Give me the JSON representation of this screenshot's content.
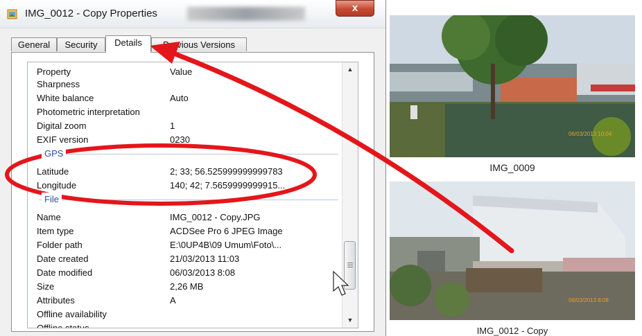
{
  "window": {
    "title": "IMG_0012 - Copy Properties",
    "close_label": "x"
  },
  "tabs": [
    {
      "label": "General",
      "active": false
    },
    {
      "label": "Security",
      "active": false
    },
    {
      "label": "Details",
      "active": true
    },
    {
      "label": "Previous Versions",
      "active": false
    }
  ],
  "details": {
    "header": {
      "property": "Property",
      "value": "Value"
    },
    "rows_top": [
      {
        "property": "Sharpness",
        "value": ""
      },
      {
        "property": "White balance",
        "value": "Auto"
      },
      {
        "property": "Photometric interpretation",
        "value": ""
      },
      {
        "property": "Digital zoom",
        "value": "1"
      },
      {
        "property": "EXIF version",
        "value": "0230"
      }
    ],
    "gps_group": "GPS",
    "rows_gps": [
      {
        "property": "Latitude",
        "value": "2; 33; 56.525999999999783"
      },
      {
        "property": "Longitude",
        "value": "140; 42; 7.5659999999915..."
      }
    ],
    "file_group": "File",
    "rows_file": [
      {
        "property": "Name",
        "value": "IMG_0012 - Copy.JPG"
      },
      {
        "property": "Item type",
        "value": "ACDSee Pro 6 JPEG Image"
      },
      {
        "property": "Folder path",
        "value": "E:\\0UP4B\\09 Umum\\Foto\\..."
      },
      {
        "property": "Date created",
        "value": "21/03/2013 11:03"
      },
      {
        "property": "Date modified",
        "value": "06/03/2013 8:08"
      },
      {
        "property": "Size",
        "value": "2,26 MB"
      },
      {
        "property": "Attributes",
        "value": "A"
      },
      {
        "property": "Offline availability",
        "value": ""
      },
      {
        "property": "Offline status",
        "value": ""
      }
    ]
  },
  "thumbnails": [
    {
      "caption": "IMG_0009",
      "timestamp": "06/03/2013 10:04"
    },
    {
      "caption": "IMG_0012 - Copy",
      "timestamp": "06/03/2013 8:08"
    }
  ],
  "colors": {
    "annotation": "#e4161b",
    "group_header": "#2a50a0"
  }
}
